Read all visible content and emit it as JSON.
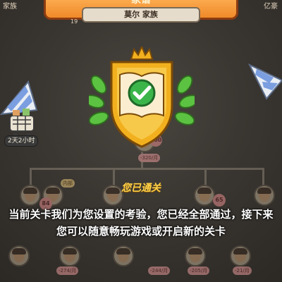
{
  "header": {
    "banner_title": "家谱",
    "family_name": "莫尔 家族",
    "left_corner": "家族",
    "right_corner": "亿豪",
    "level": "19"
  },
  "side": {
    "timer": "2天2小时"
  },
  "tree": {
    "scores": [
      "100",
      "84",
      "65"
    ],
    "tags": [
      "-320/月",
      "-274/月",
      "-244/月",
      "-205/月",
      "-21/月",
      "内部"
    ]
  },
  "result": {
    "status": "您已通关",
    "message": "当前关卡我们为您设置的考验，您已经全部通过，接下来您可以随意畅玩游戏或开启新的关卡"
  },
  "colors": {
    "banner": "#f08a2a",
    "shield": "#f2b01e",
    "check": "#3bb54a",
    "laurel": "#5cc242",
    "status_text": "#ffd24a"
  }
}
